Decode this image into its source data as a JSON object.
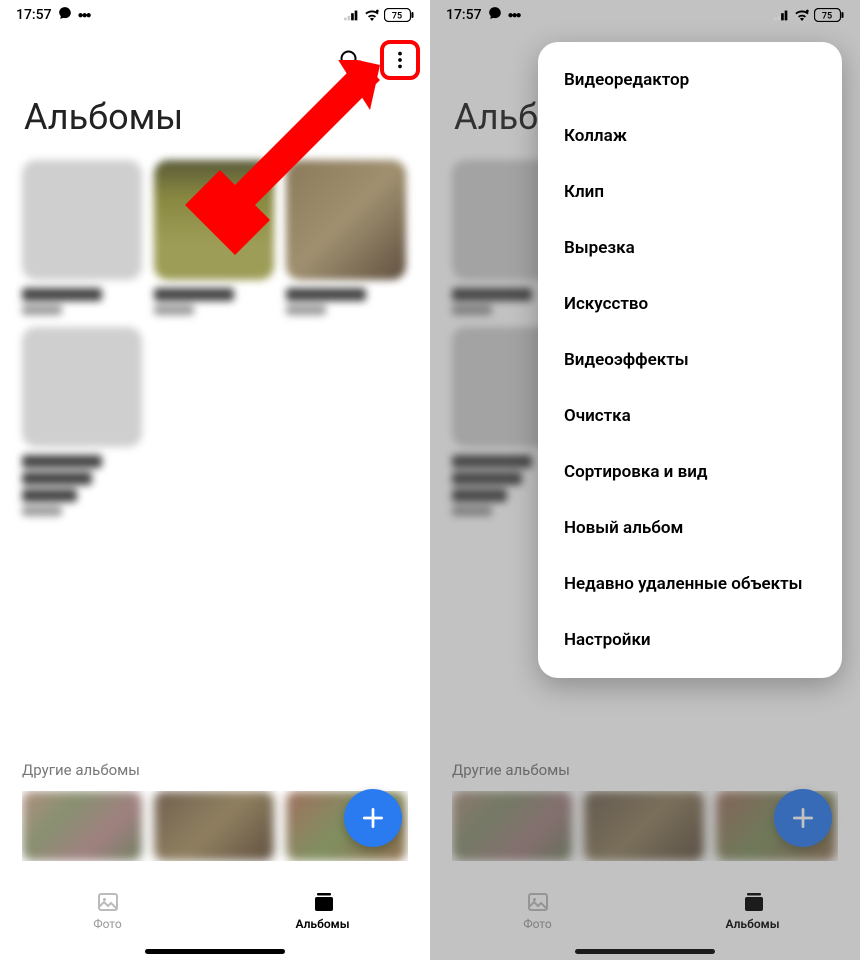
{
  "status": {
    "time": "17:57",
    "battery": "75"
  },
  "page_title": "Альбомы",
  "other_albums_label": "Другие альбомы",
  "bottom_nav": {
    "photo": "Фото",
    "albums": "Альбомы"
  },
  "menu": {
    "items": [
      "Видеоредактор",
      "Коллаж",
      "Клип",
      "Вырезка",
      "Искусство",
      "Видеоэффекты",
      "Очистка",
      "Сортировка и вид",
      "Новый альбом",
      "Недавно удаленные объекты",
      "Настройки"
    ]
  }
}
